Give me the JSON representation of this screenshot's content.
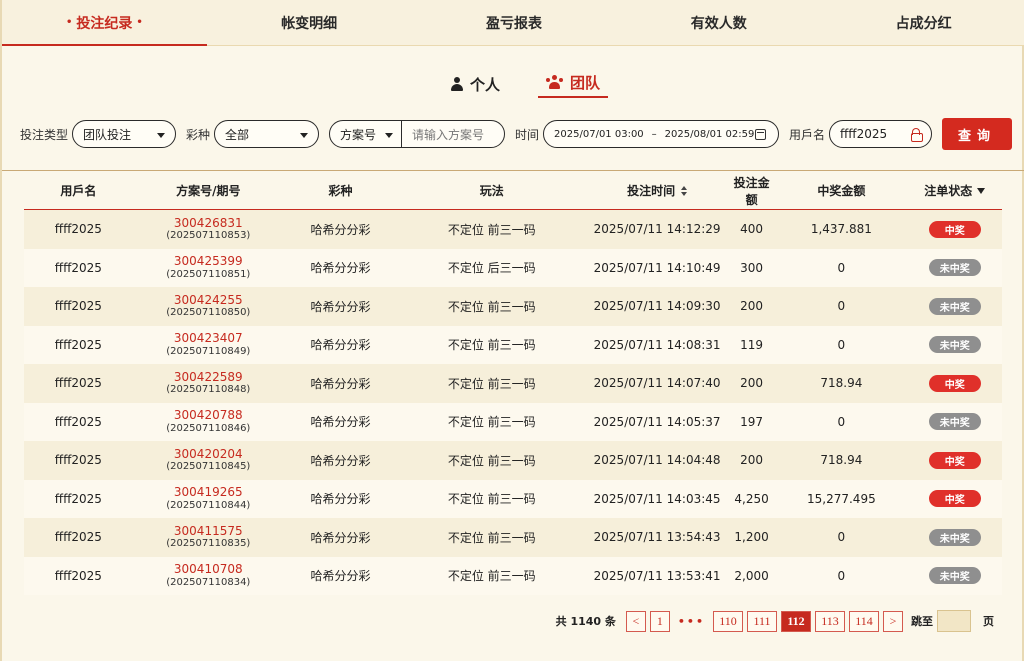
{
  "tabs": [
    {
      "label": "投注纪录"
    },
    {
      "label": "帐变明细"
    },
    {
      "label": "盈亏报表"
    },
    {
      "label": "有效人数"
    },
    {
      "label": "占成分红"
    }
  ],
  "tab_active_marker": "•",
  "sub_tabs": {
    "personal": "个人",
    "team": "团队"
  },
  "filters": {
    "bet_type_label": "投注类型",
    "bet_type_value": "团队投注",
    "lottery_label": "彩种",
    "lottery_value": "全部",
    "scheme_select": "方案号",
    "scheme_placeholder": "请输入方案号",
    "time_label": "时间",
    "time_start": "2025/07/01 03:00",
    "time_sep": "–",
    "time_end": "2025/08/01 02:59",
    "user_label": "用戶名",
    "user_value": "ffff2025",
    "query_label": "查询"
  },
  "table": {
    "headers": [
      "用戶名",
      "方案号/期号",
      "彩种",
      "玩法",
      "投注时间",
      "投注金额",
      "中奖金额",
      "注单状态"
    ],
    "rows": [
      {
        "user": "ffff2025",
        "scheme": "300426831",
        "period": "(202507110853)",
        "lottery": "哈希分分彩",
        "play": "不定位 前三一码",
        "time": "2025/07/11 14:12:29",
        "amount": "400",
        "win": "1,437.881",
        "status": "中奖",
        "won": true
      },
      {
        "user": "ffff2025",
        "scheme": "300425399",
        "period": "(202507110851)",
        "lottery": "哈希分分彩",
        "play": "不定位 后三一码",
        "time": "2025/07/11 14:10:49",
        "amount": "300",
        "win": "0",
        "status": "未中奖",
        "won": false
      },
      {
        "user": "ffff2025",
        "scheme": "300424255",
        "period": "(202507110850)",
        "lottery": "哈希分分彩",
        "play": "不定位 前三一码",
        "time": "2025/07/11 14:09:30",
        "amount": "200",
        "win": "0",
        "status": "未中奖",
        "won": false
      },
      {
        "user": "ffff2025",
        "scheme": "300423407",
        "period": "(202507110849)",
        "lottery": "哈希分分彩",
        "play": "不定位 前三一码",
        "time": "2025/07/11 14:08:31",
        "amount": "119",
        "win": "0",
        "status": "未中奖",
        "won": false
      },
      {
        "user": "ffff2025",
        "scheme": "300422589",
        "period": "(202507110848)",
        "lottery": "哈希分分彩",
        "play": "不定位 前三一码",
        "time": "2025/07/11 14:07:40",
        "amount": "200",
        "win": "718.94",
        "status": "中奖",
        "won": true
      },
      {
        "user": "ffff2025",
        "scheme": "300420788",
        "period": "(202507110846)",
        "lottery": "哈希分分彩",
        "play": "不定位 前三一码",
        "time": "2025/07/11 14:05:37",
        "amount": "197",
        "win": "0",
        "status": "未中奖",
        "won": false
      },
      {
        "user": "ffff2025",
        "scheme": "300420204",
        "period": "(202507110845)",
        "lottery": "哈希分分彩",
        "play": "不定位 前三一码",
        "time": "2025/07/11 14:04:48",
        "amount": "200",
        "win": "718.94",
        "status": "中奖",
        "won": true
      },
      {
        "user": "ffff2025",
        "scheme": "300419265",
        "period": "(202507110844)",
        "lottery": "哈希分分彩",
        "play": "不定位 前三一码",
        "time": "2025/07/11 14:03:45",
        "amount": "4,250",
        "win": "15,277.495",
        "status": "中奖",
        "won": true
      },
      {
        "user": "ffff2025",
        "scheme": "300411575",
        "period": "(202507110835)",
        "lottery": "哈希分分彩",
        "play": "不定位 前三一码",
        "time": "2025/07/11 13:54:43",
        "amount": "1,200",
        "win": "0",
        "status": "未中奖",
        "won": false
      },
      {
        "user": "ffff2025",
        "scheme": "300410708",
        "period": "(202507110834)",
        "lottery": "哈希分分彩",
        "play": "不定位 前三一码",
        "time": "2025/07/11 13:53:41",
        "amount": "2,000",
        "win": "0",
        "status": "未中奖",
        "won": false
      }
    ]
  },
  "pagination": {
    "total": "共 1140 条",
    "prev": "<",
    "first": "1",
    "ellipsis": "•••",
    "pages": [
      "110",
      "111",
      "112",
      "113",
      "114"
    ],
    "current": "112",
    "next": ">",
    "jump_label": "跳至",
    "page_unit": "页"
  },
  "colors": {
    "accent": "#c62a1f",
    "won_badge": "#e0302a",
    "lost_badge": "#8f8f8f"
  }
}
